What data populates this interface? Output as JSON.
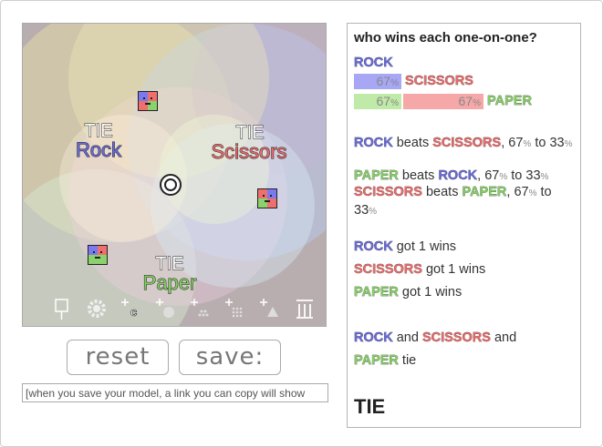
{
  "candidates": {
    "rock": {
      "label": "Rock",
      "color": "#6a6ad8"
    },
    "scissors": {
      "label": "Scissors",
      "color": "#e86a6a"
    },
    "paper": {
      "label": "Paper",
      "color": "#86cc66"
    }
  },
  "zones": {
    "tie": "TIE"
  },
  "center_marker_icon": "target-icon",
  "toolbar": {
    "icons": [
      "arrow-down-icon",
      "gear-icon",
      "add-candidate-icon",
      "add-voter-icon",
      "add-crowd-icon",
      "add-grid-voters-icon",
      "add-triangle-icon",
      "columns-icon"
    ]
  },
  "buttons": {
    "reset": "reset",
    "save": "save:"
  },
  "save_note": "[when you save your model, a link you can copy will show",
  "panel": {
    "title": "who wins each one-on-one?",
    "matrix": {
      "row1_label": "ROCK",
      "rock_score": "67",
      "scissors_label": "SCISSORS",
      "row3_left": "67",
      "row3_right": "67",
      "paper_label": "PAPER",
      "pct_sign": "%"
    },
    "results": [
      {
        "winner": "ROCK",
        "verb": "beats",
        "loser": "SCISSORS",
        "pct_a": "67",
        "to": "to",
        "pct_b": "33"
      },
      {
        "winner": "PAPER",
        "verb": "beats",
        "loser": "ROCK",
        "pct_a": "67",
        "to": "to",
        "pct_b": "33"
      },
      {
        "winner": "SCISSORS",
        "verb": "beats",
        "loser": "PAPER",
        "pct_a": "67",
        "to": "to",
        "pct_b": "33"
      }
    ],
    "wins": [
      {
        "name": "ROCK",
        "text": "got 1 wins"
      },
      {
        "name": "SCISSORS",
        "text": "got 1 wins"
      },
      {
        "name": "PAPER",
        "text": "got 1 wins"
      }
    ],
    "tie_line": {
      "a": "ROCK",
      "and1": "and",
      "b": "SCISSORS",
      "and2": "and",
      "c": "PAPER",
      "tie": "tie"
    },
    "final": "TIE"
  }
}
